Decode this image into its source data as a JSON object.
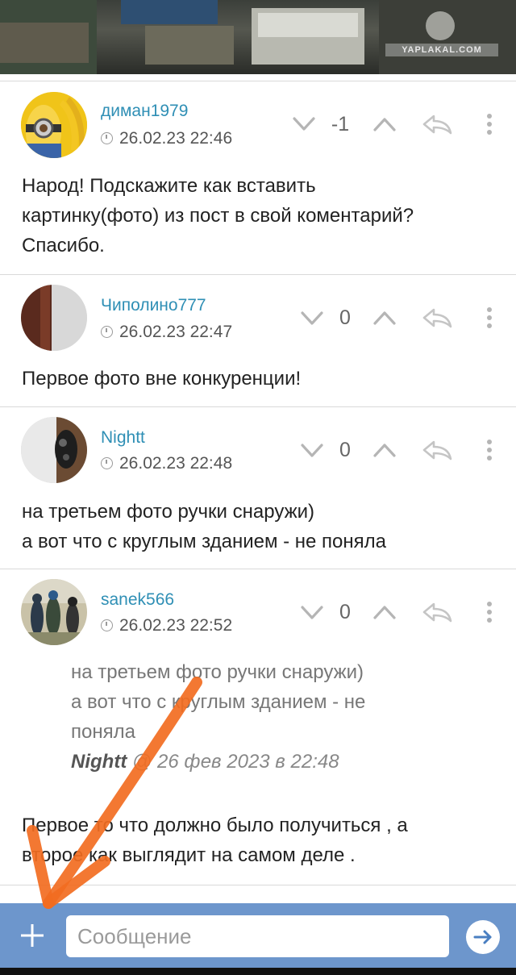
{
  "banner": {
    "watermark": "YAPLAKAL.COM"
  },
  "comments": [
    {
      "username": "диман1979",
      "timestamp": "26.02.23 22:46",
      "score": "-1",
      "text_lines": [
        "Народ! Подскажите как вставить",
        "картинку(фото) из пост в свой коментарий?",
        "Спасибо."
      ]
    },
    {
      "username": "Чиполино777",
      "timestamp": "26.02.23 22:47",
      "score": "0",
      "text_lines": [
        "Первое фото вне конкуренции!"
      ]
    },
    {
      "username": "Nightt",
      "timestamp": "26.02.23 22:48",
      "score": "0",
      "text_lines": [
        "на третьем фото ручки снаружи)",
        "а вот что с круглым зданием - не поняла"
      ]
    },
    {
      "username": "sanek566",
      "timestamp": "26.02.23 22:52",
      "score": "0",
      "quote_lines": [
        "на третьем фото ручки снаружи)",
        "а вот что с круглым зданием - не",
        "поняла"
      ],
      "quote_author": "Nightt",
      "quote_meta": "@ 26 фев 2023 в 22:48",
      "text_lines": [
        "Первое то что должно было получиться , а",
        "второе как выглядит на самом деле ."
      ]
    }
  ],
  "composer": {
    "placeholder": "Сообщение"
  },
  "colors": {
    "link": "#2f8fb5",
    "bar": "#6d96cc",
    "annotation": "#f26d21"
  },
  "icons": [
    "chevron-down-icon",
    "chevron-up-icon",
    "reply-icon",
    "more-vertical-icon",
    "clock-icon",
    "plus-icon",
    "arrow-right-icon"
  ]
}
